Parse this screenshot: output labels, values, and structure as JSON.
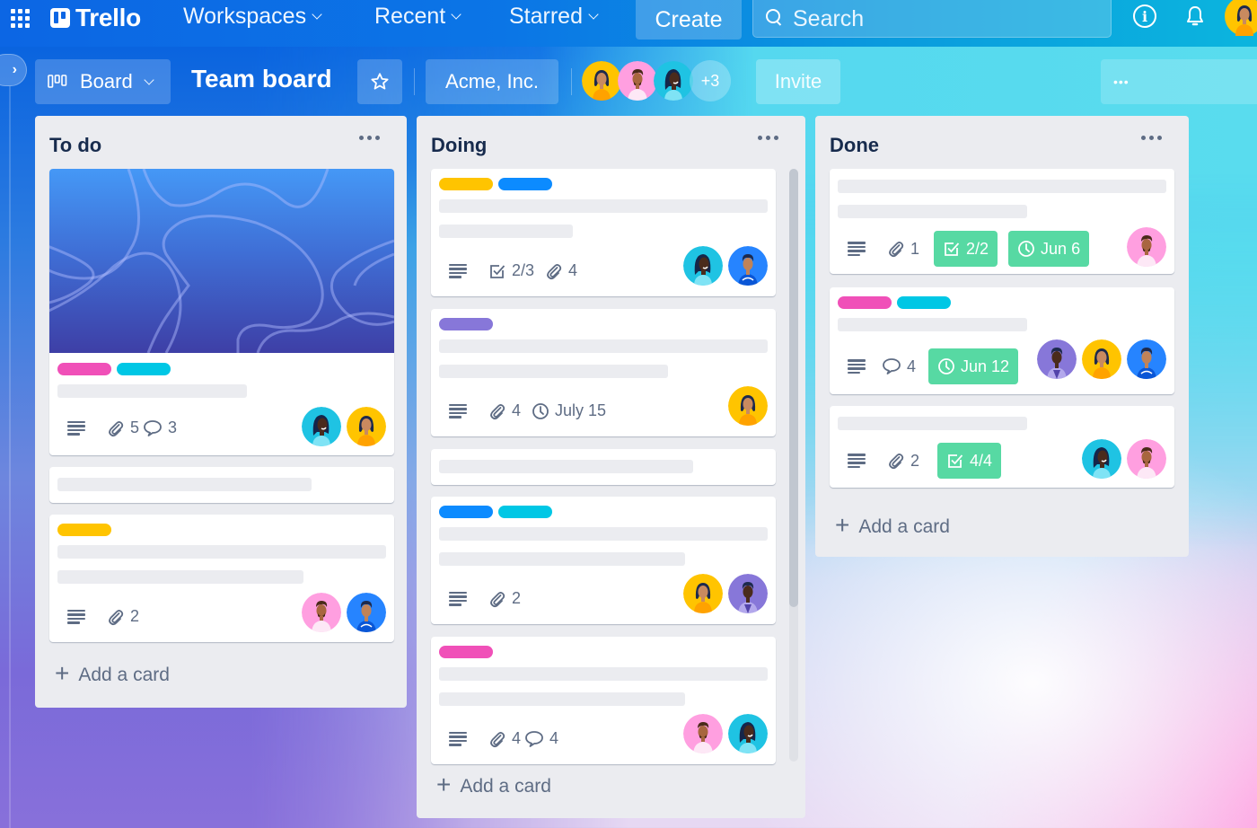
{
  "app": {
    "name": "Trello",
    "nav": {
      "workspaces": "Workspaces",
      "recent": "Recent",
      "starred": "Starred",
      "create": "Create",
      "search_placeholder": "Search"
    }
  },
  "board": {
    "view_label": "Board",
    "title": "Team board",
    "workspace": "Acme, Inc.",
    "members_extra": "+3",
    "invite_label": "Invite",
    "more_label": "•••"
  },
  "colors": {
    "label_pink": "#f050b8",
    "label_cyan": "#00c7e5",
    "label_yellow": "#ffc400",
    "label_blue": "#0c8bff",
    "label_purple": "#8777d9",
    "badge_green": "#57d9a3"
  },
  "lists": [
    {
      "title": "To do",
      "add_card": "Add a card",
      "cards": [
        {
          "cover": true,
          "labels": [
            "pink",
            "cyan"
          ],
          "attachments": "5",
          "comments": "3",
          "members": [
            "teal-woman",
            "yellow-woman"
          ]
        },
        {
          "labels": []
        },
        {
          "labels": [
            "yellow"
          ],
          "attachments": "2",
          "members": [
            "pink-man",
            "blue-man"
          ]
        }
      ]
    },
    {
      "title": "Doing",
      "add_card": "Add a card",
      "cards": [
        {
          "labels": [
            "yellow",
            "blue"
          ],
          "checklist": "2/3",
          "attachments": "4",
          "members": [
            "teal-woman",
            "blue-man"
          ]
        },
        {
          "labels": [
            "purple"
          ],
          "attachments": "4",
          "due": "July 15",
          "members": [
            "yellow-woman"
          ]
        },
        {
          "labels": []
        },
        {
          "labels": [
            "blue",
            "cyan"
          ],
          "attachments": "2",
          "members": [
            "yellow-woman",
            "purple-man"
          ]
        },
        {
          "labels": [
            "pink"
          ],
          "attachments": "4",
          "comments": "4",
          "members": [
            "pink-man",
            "teal-woman"
          ]
        }
      ]
    },
    {
      "title": "Done",
      "add_card": "Add a card",
      "cards": [
        {
          "labels": [],
          "attachments": "1",
          "checklist": "2/2",
          "due": "Jun 6",
          "members": [
            "pink-man"
          ]
        },
        {
          "labels": [
            "pink",
            "cyan"
          ],
          "comments": "4",
          "due": "Jun 12",
          "members": [
            "purple-man",
            "yellow-woman",
            "blue-man"
          ]
        },
        {
          "labels": [],
          "attachments": "2",
          "checklist": "4/4",
          "members": [
            "teal-woman",
            "pink-man"
          ]
        }
      ]
    }
  ]
}
